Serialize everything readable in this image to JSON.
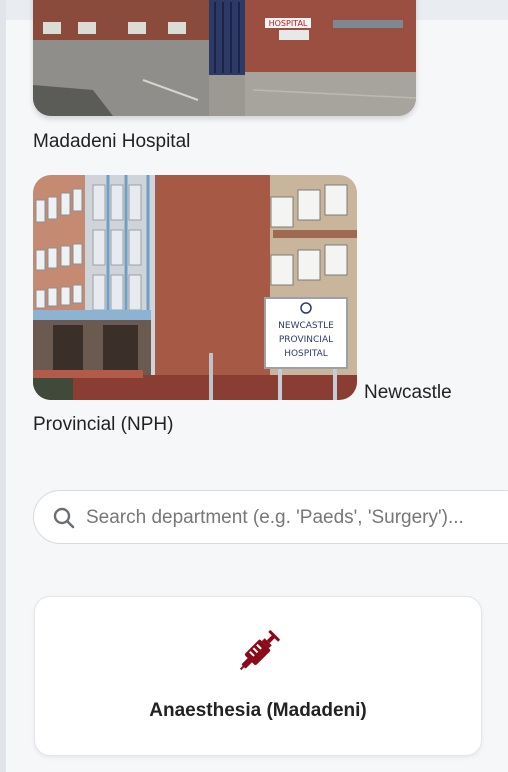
{
  "hospitals": [
    {
      "caption": "Madadeni Hospital",
      "photo_icon": "madadeni-hospital-photo"
    },
    {
      "caption_part1": "Newcastle",
      "caption_part2": "Provincial (NPH)",
      "photo_icon": "newcastle-hospital-photo",
      "sign_lines": [
        "NEWCASTLE",
        "PROVINCIAL",
        "HOSPITAL"
      ],
      "gate_sign": "HOSPITAL"
    }
  ],
  "search": {
    "placeholder": "Search department (e.g. 'Paeds', 'Surgery')...",
    "value": "",
    "icon": "search-icon"
  },
  "departments": [
    {
      "name": "Anaesthesia (Madadeni)",
      "icon": "syringe-icon",
      "icon_color": "#8b0a1a"
    }
  ],
  "colors": {
    "accent": "#8b0a1a",
    "card_bg": "#ffffff",
    "page_bg": "#f6f7f9"
  }
}
